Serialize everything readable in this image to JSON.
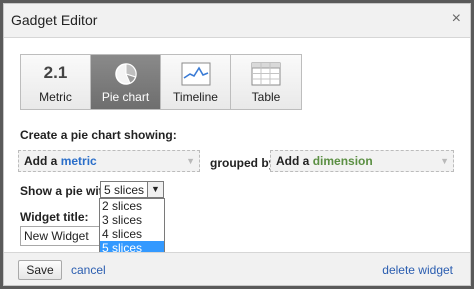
{
  "dialog": {
    "title": "Gadget Editor",
    "close_glyph": "×"
  },
  "tabs": [
    {
      "label": "Metric",
      "icon": "number-icon",
      "icon_text": "2.1",
      "selected": false
    },
    {
      "label": "Pie chart",
      "icon": "pie-chart-icon",
      "selected": true
    },
    {
      "label": "Timeline",
      "icon": "timeline-icon",
      "selected": false
    },
    {
      "label": "Table",
      "icon": "table-icon",
      "selected": false
    }
  ],
  "form": {
    "heading": "Create a pie chart showing:",
    "metric_select": {
      "prefix": "Add a",
      "word": "metric"
    },
    "grouped_by": "grouped by",
    "dimension_select": {
      "prefix": "Add a",
      "word": "dimension"
    },
    "pie_label": "Show a pie with",
    "slices_value": "5 slices",
    "slices_options": [
      "2 slices",
      "3 slices",
      "4 slices",
      "5 slices"
    ],
    "slices_selected_index": 3,
    "widget_title_label": "Widget title:",
    "widget_title_value": "New Widget"
  },
  "footer": {
    "save": "Save",
    "cancel": "cancel",
    "delete": "delete widget"
  },
  "colors": {
    "selected_tab": "#7c7c7c",
    "link": "#2a5db0",
    "metric_word": "#2a6ec9",
    "dimension_word": "#5b8f43",
    "option_highlight": "#3399ff"
  }
}
